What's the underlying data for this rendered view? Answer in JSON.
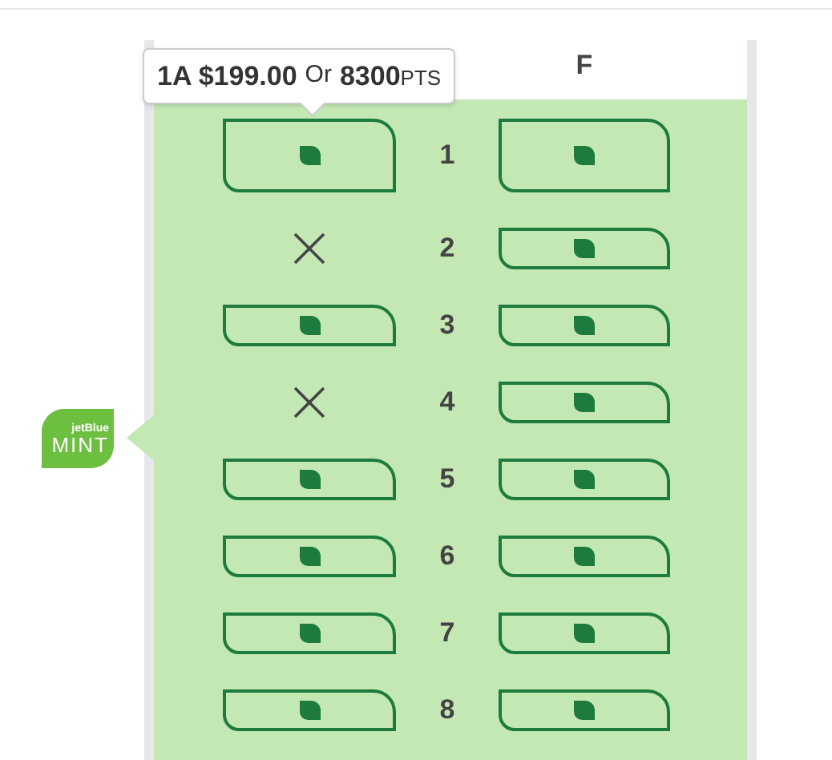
{
  "header": {
    "column_2": "F"
  },
  "tooltip": {
    "seat": "1A",
    "price": "$199.00",
    "or": "Or",
    "points": "8300",
    "points_unit": "PTS"
  },
  "cabin_badge": {
    "brand": "jetBlue",
    "cabin": "MINT"
  },
  "rows": [
    {
      "number": "1",
      "seats": [
        {
          "kind": "available"
        },
        {
          "kind": "available"
        }
      ]
    },
    {
      "number": "2",
      "seats": [
        {
          "kind": "blocked"
        },
        {
          "kind": "available"
        }
      ]
    },
    {
      "number": "3",
      "seats": [
        {
          "kind": "available"
        },
        {
          "kind": "available"
        }
      ]
    },
    {
      "number": "4",
      "seats": [
        {
          "kind": "blocked"
        },
        {
          "kind": "available"
        }
      ]
    },
    {
      "number": "5",
      "seats": [
        {
          "kind": "available"
        },
        {
          "kind": "available"
        }
      ]
    },
    {
      "number": "6",
      "seats": [
        {
          "kind": "available"
        },
        {
          "kind": "available"
        }
      ]
    },
    {
      "number": "7",
      "seats": [
        {
          "kind": "available"
        },
        {
          "kind": "available"
        }
      ]
    },
    {
      "number": "8",
      "seats": [
        {
          "kind": "available"
        },
        {
          "kind": "available"
        }
      ]
    }
  ]
}
